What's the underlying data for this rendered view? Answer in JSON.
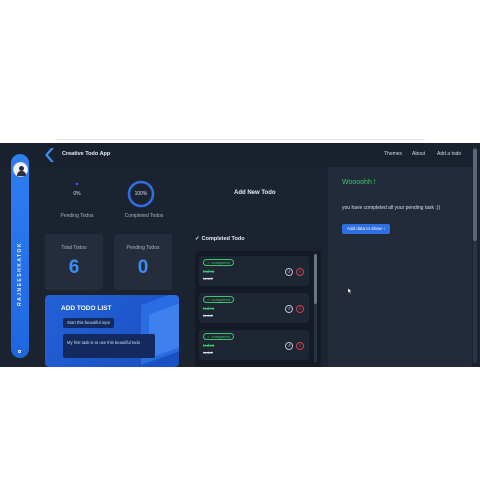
{
  "navbar": {
    "title": "Creative Todo App",
    "links": [
      "Themes",
      "About",
      "Add a todo"
    ]
  },
  "sidebar": {
    "name": "RAJNEESHKATOK"
  },
  "stats": {
    "pending_percent": "0%",
    "pending_label": "Pending Todos",
    "completed_percent": "100%",
    "completed_label": "Completed Todos",
    "completed_fraction": 1.0
  },
  "cards": [
    {
      "title": "Total Todos",
      "value": "6"
    },
    {
      "title": "Pending Todos",
      "value": "0"
    }
  ],
  "add_list": {
    "title": "ADD TODO LIST",
    "items": [
      "Start this beautiful repo",
      "My first task is to use this beautiful todo"
    ]
  },
  "middle": {
    "add_title": "Add New Todo",
    "completed_header": "Completed Todo",
    "items": [
      {
        "badge": "completed",
        "title": "todo1",
        "desc": "todo1"
      },
      {
        "badge": "completed",
        "title": "todo1",
        "desc": "todo1"
      },
      {
        "badge": "completed",
        "title": "todo1",
        "desc": "todo1"
      }
    ]
  },
  "right_panel": {
    "heading": "Woooohh !",
    "message": "you have completed all your pending task :))",
    "button": "Add data to show ↑"
  },
  "colors": {
    "accent": "#2f6fe4",
    "success": "#3ec46d",
    "danger": "#d04545",
    "bg": "#1b2230"
  }
}
